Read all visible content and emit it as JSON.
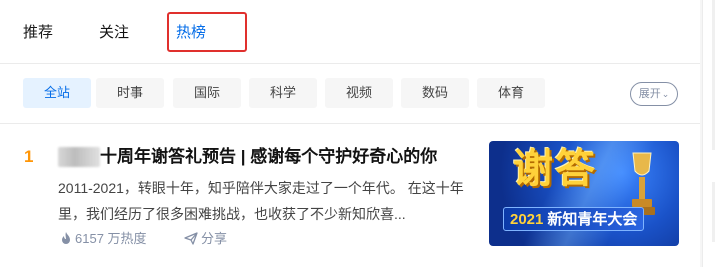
{
  "tabs": [
    {
      "label": "推荐",
      "active": false
    },
    {
      "label": "关注",
      "active": false
    },
    {
      "label": "热榜",
      "active": true
    }
  ],
  "filters": {
    "chips": [
      {
        "label": "全站",
        "active": true
      },
      {
        "label": "时事",
        "active": false
      },
      {
        "label": "国际",
        "active": false
      },
      {
        "label": "科学",
        "active": false
      },
      {
        "label": "视频",
        "active": false
      },
      {
        "label": "数码",
        "active": false
      },
      {
        "label": "体育",
        "active": false
      }
    ],
    "expand_label": "展开"
  },
  "hot_item": {
    "rank": "1",
    "title": "十周年谢答礼预告 | 感谢每个守护好奇心的你",
    "excerpt": "2011-2021，转眼十年，知乎陪伴大家走过了一个年代。 在这十年里，我们经历了很多困难挑战，也收获了不少新知欣喜...",
    "heat": "6157 万热度",
    "share_label": "分享",
    "thumbnail": {
      "big_text": "谢答",
      "year": "2021",
      "ribbon_text": "新知青年大会"
    }
  },
  "colors": {
    "accent": "#056de8",
    "rank": "#ff9607",
    "highlight_box": "#e0302d"
  },
  "icons": {
    "heat": "flame-icon",
    "share": "paper-plane-icon",
    "expand": "chevron-down-icon"
  }
}
